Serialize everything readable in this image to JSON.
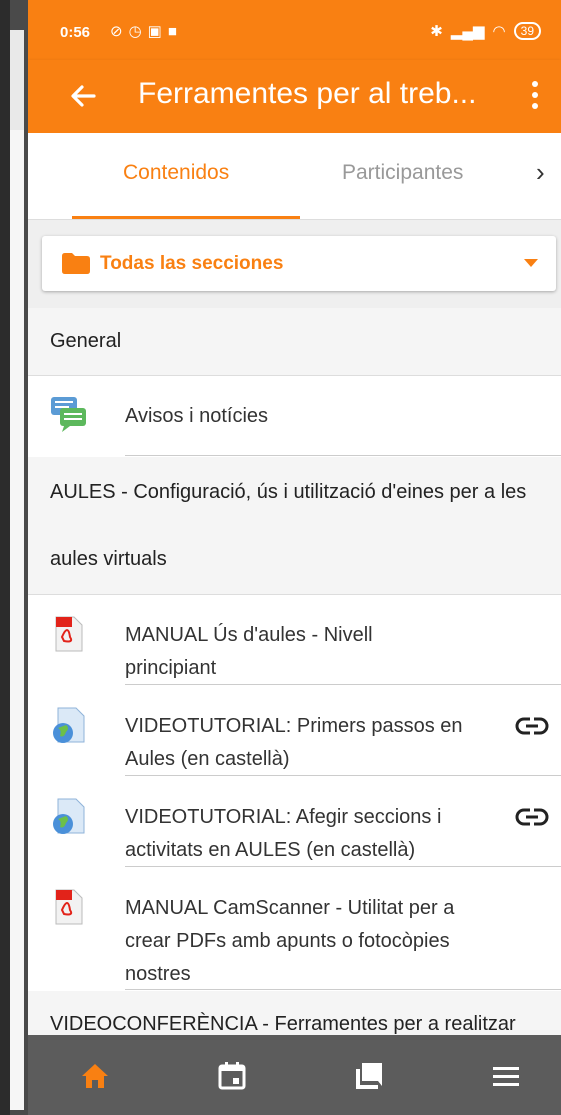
{
  "status_bar": {
    "time": "0:56",
    "battery": "39"
  },
  "app_bar": {
    "title": "Ferramentes per al treb..."
  },
  "tabs": [
    {
      "label": "Contenidos",
      "active": true
    },
    {
      "label": "Participantes",
      "active": false
    }
  ],
  "section_selector": {
    "label": "Todas las secciones"
  },
  "sections": [
    {
      "title": "General",
      "items": [
        {
          "label": "Avisos i notícies",
          "icon": "forum-icon"
        }
      ]
    },
    {
      "title_line1": "AULES - Configuració, ús i utilització d'eines per a les",
      "title_line2": "aules virtuals",
      "items": [
        {
          "line1": "MANUAL Ús d'aules - Nivell",
          "line2": "principiant",
          "icon": "pdf-icon"
        },
        {
          "line1": "VIDEOTUTORIAL: Primers passos en",
          "line2": "Aules (en castellà)",
          "icon": "url-icon",
          "trailing": "link-icon"
        },
        {
          "line1": "VIDEOTUTORIAL: Afegir seccions i",
          "line2": "activitats en AULES (en castellà)",
          "icon": "url-icon",
          "trailing": "link-icon"
        },
        {
          "line1": "MANUAL CamScanner - Utilitat per a",
          "line2": "crear PDFs amb apunts o fotocòpies",
          "line3": "nostres",
          "icon": "pdf-icon"
        }
      ]
    },
    {
      "title": "VIDEOCONFERÈNCIA - Ferramentes per a realitzar"
    }
  ],
  "bottom_nav": [
    "home-icon",
    "calendar-icon",
    "messages-icon",
    "more-menu-icon"
  ],
  "colors": {
    "accent": "#f98012",
    "nav_bg": "#5c5c5c"
  }
}
